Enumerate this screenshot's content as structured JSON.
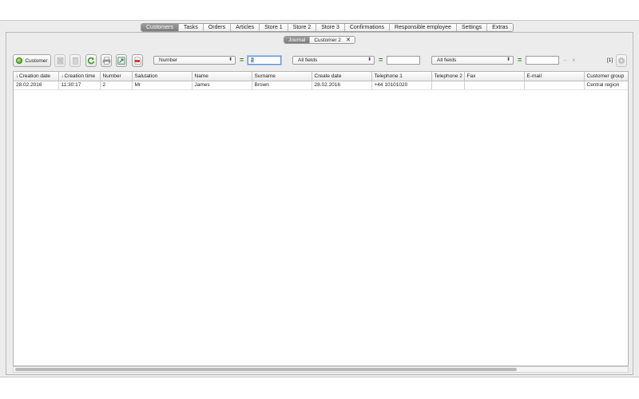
{
  "main_tabs": [
    "Customers",
    "Tasks",
    "Orders",
    "Articles",
    "Store 1",
    "Store 2",
    "Store 3",
    "Confirmations",
    "Responsible employee",
    "Settings",
    "Extras"
  ],
  "active_main_tab": "Customers",
  "sub_tabs": {
    "journal": "Journal",
    "record": "Customer 2",
    "close_glyph": "✕"
  },
  "toolbar": {
    "add_label": "Customer",
    "filters": [
      {
        "field": "Number",
        "value": "2"
      },
      {
        "field": "All fields",
        "value": ""
      },
      {
        "field": "All fields",
        "value": ""
      }
    ],
    "equals": "=",
    "dash": "–",
    "clear": "×",
    "page_count": "[1]",
    "icons": [
      "add-icon",
      "delete-icon",
      "trash-icon",
      "refresh-icon",
      "print-icon",
      "export-icon",
      "pdf-icon",
      "gear-icon"
    ]
  },
  "table": {
    "columns": [
      "Creation date",
      "Creation time",
      "Number",
      "Salutation",
      "Name",
      "Surname",
      "Create date",
      "Telephone 1",
      "Telephone 2",
      "Fax",
      "E-mail",
      "Customer group"
    ],
    "sorted_columns": [
      "Creation date",
      "Creation time"
    ],
    "rows": [
      [
        "28.02.2016",
        "11:30:17",
        "2",
        "Mr",
        "James",
        "Brown",
        "28.02.2016",
        "+44 10101020",
        "",
        "",
        "",
        "Central region"
      ]
    ]
  },
  "colors": {
    "active_tab": "#8a8a8a",
    "equals": "#2f8a1f",
    "focus": "#5b8fd6"
  }
}
